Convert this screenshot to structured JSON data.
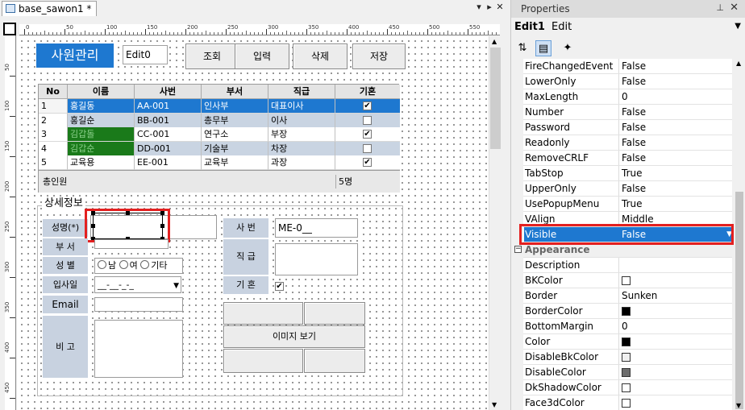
{
  "designer": {
    "tab_label": "base_sawon1 *",
    "tab_buttons": [
      "▾",
      "▸",
      "✕"
    ],
    "ruler_top_ticks": [
      "0",
      "50",
      "100",
      "150",
      "200",
      "250",
      "300",
      "350",
      "400",
      "450",
      "500",
      "550"
    ],
    "ruler_left_ticks": [
      "50",
      "100",
      "150",
      "200",
      "250",
      "300",
      "350",
      "400",
      "450"
    ]
  },
  "form": {
    "title": "사원관리",
    "edit0_value": "Edit0",
    "buttons": [
      "조회",
      "입력",
      "삭제",
      "저장"
    ],
    "grid": {
      "columns": [
        "No",
        "이름",
        "사번",
        "부서",
        "직급",
        "기혼"
      ],
      "rows": [
        {
          "no": "1",
          "name": "홍길동",
          "id": "AA-001",
          "dept": "인사부",
          "rank": "대표이사",
          "married": true
        },
        {
          "no": "2",
          "name": "홍길순",
          "id": "BB-001",
          "dept": "총무부",
          "rank": "이사",
          "married": false
        },
        {
          "no": "3",
          "name": "김갑돌",
          "id": "CC-001",
          "dept": "연구소",
          "rank": "부장",
          "married": true
        },
        {
          "no": "4",
          "name": "김갑순",
          "id": "DD-001",
          "dept": "기술부",
          "rank": "차장",
          "married": false
        },
        {
          "no": "5",
          "name": "교육용",
          "id": "EE-001",
          "dept": "교육부",
          "rank": "과장",
          "married": true
        }
      ],
      "footer_label": "총인원",
      "footer_count": "5명"
    },
    "detail": {
      "group_title": "상세정보",
      "label_name": "성명(*)",
      "label_dept": "부 서",
      "label_gender": "성 별",
      "gender_options": [
        "남",
        "여",
        "기타"
      ],
      "label_hiredate": "입사일",
      "hiredate_mask": "__-__-_-_",
      "label_email": "Email",
      "label_memo": "비 고",
      "label_empno": "사 번",
      "empno_value": "ME-0__",
      "label_rank": "직 급",
      "label_married": "기 혼",
      "married_checked": true,
      "image_button": "이미지 보기"
    }
  },
  "properties": {
    "title": "Properties",
    "pin_icon": "📌",
    "object_name": "Edit1",
    "object_type": "Edit",
    "rows": [
      {
        "name": "FireChangedEvent",
        "value": "False"
      },
      {
        "name": "LowerOnly",
        "value": "False"
      },
      {
        "name": "MaxLength",
        "value": "0"
      },
      {
        "name": "Number",
        "value": "False"
      },
      {
        "name": "Password",
        "value": "False"
      },
      {
        "name": "Readonly",
        "value": "False"
      },
      {
        "name": "RemoveCRLF",
        "value": "False"
      },
      {
        "name": "TabStop",
        "value": "True"
      },
      {
        "name": "UpperOnly",
        "value": "False"
      },
      {
        "name": "UsePopupMenu",
        "value": "True"
      },
      {
        "name": "VAlign",
        "value": "Middle"
      },
      {
        "name": "Visible",
        "value": "False",
        "selected": true
      },
      {
        "name": "Appearance",
        "category": true
      },
      {
        "name": "Description",
        "value": ""
      },
      {
        "name": "BKColor",
        "value": "",
        "swatch": "#ffffff"
      },
      {
        "name": "Border",
        "value": "Sunken"
      },
      {
        "name": "BorderColor",
        "value": "",
        "swatch": "#000000"
      },
      {
        "name": "BottomMargin",
        "value": "0"
      },
      {
        "name": "Color",
        "value": "",
        "swatch": "#000000"
      },
      {
        "name": "DisableBkColor",
        "value": "",
        "swatch": "#f0f0f0"
      },
      {
        "name": "DisableColor",
        "value": "",
        "swatch": "#6d6d6d"
      },
      {
        "name": "DkShadowColor",
        "value": "",
        "swatch": "#ffffff"
      },
      {
        "name": "Face3dColor",
        "value": "",
        "swatch": "#ffffff"
      }
    ]
  },
  "colors": {
    "accent": "#1e78d0",
    "highlight_red": "#e32020",
    "grid_row_alt": "#c9d4e2",
    "grid_name_green": "#1a7a1a"
  }
}
